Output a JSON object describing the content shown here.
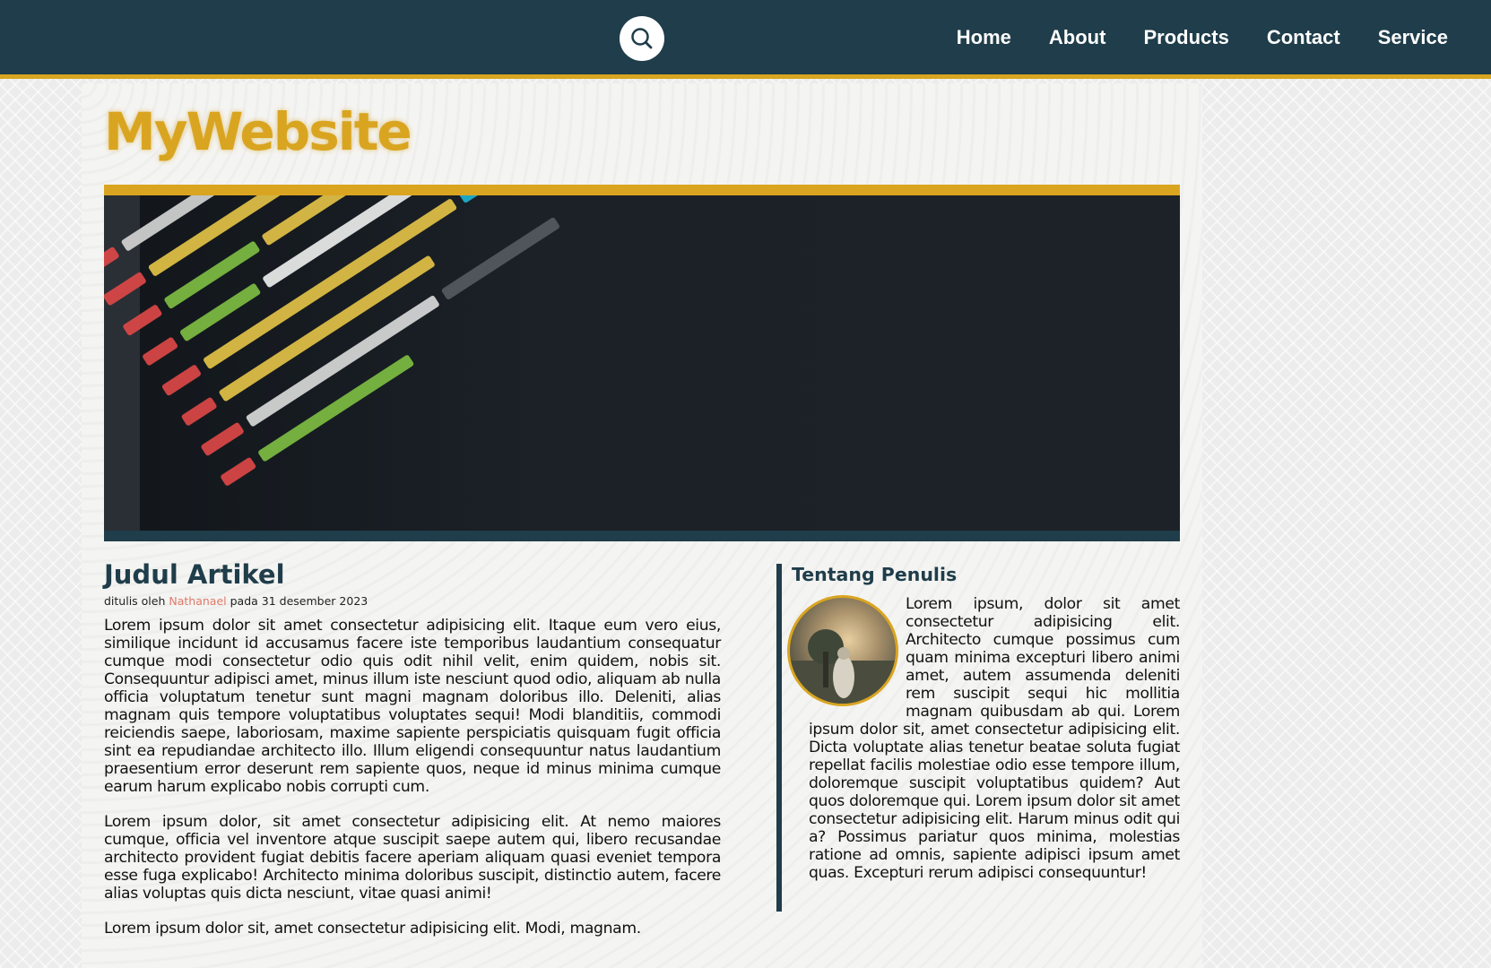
{
  "nav": {
    "search_icon": "search-icon",
    "links": [
      "Home",
      "About",
      "Products",
      "Contact",
      "Service"
    ]
  },
  "site": {
    "title": "MyWebsite"
  },
  "colors": {
    "navy": "#1f3d4a",
    "gold": "#d9a520",
    "author_link": "#e07a6a"
  },
  "article": {
    "title": "Judul Artikel",
    "byline_prefix": "ditulis oleh",
    "author": "Nathanael",
    "byline_suffix": "pada 31 desember 2023",
    "paragraphs": [
      "Lorem ipsum dolor sit amet consectetur adipisicing elit. Itaque eum vero eius, similique incidunt id accusamus facere iste temporibus laudantium consequatur cumque modi consectetur odio quis odit nihil velit, enim quidem, nobis sit. Consequuntur adipisci amet, minus illum iste nesciunt quod odio, aliquam ab nulla officia voluptatum tenetur sunt magni magnam doloribus illo. Deleniti, alias magnam quis tempore voluptatibus voluptates sequi! Modi blanditiis, commodi reiciendis saepe, laboriosam, maxime sapiente perspiciatis quisquam fugit officia sint ea repudiandae architecto illo. Illum eligendi consequuntur natus laudantium praesentium error deserunt rem sapiente quos, neque id minus minima cumque earum harum explicabo nobis corrupti cum.",
      "Lorem ipsum dolor, sit amet consectetur adipisicing elit. At nemo maiores cumque, officia vel inventore atque suscipit saepe autem qui, libero recusandae architecto provident fugiat debitis facere aperiam aliquam quasi eveniet tempora esse fuga explicabo! Architecto minima doloribus suscipit, distinctio autem, facere alias voluptas quis dicta nesciunt, vitae quasi animi!",
      "Lorem ipsum dolor sit, amet consectetur adipisicing elit. Modi, magnam."
    ]
  },
  "sidebar": {
    "title": "Tentang Penulis",
    "text": "Lorem ipsum, dolor sit amet consectetur adipisicing elit. Architecto cumque possimus cum quam minima excepturi libero animi amet, autem assumenda deleniti rem suscipit sequi hic mollitia magnam quibusdam ab qui. Lorem ipsum dolor sit, amet consectetur adipisicing elit. Dicta voluptate alias tenetur beatae soluta fugiat repellat facilis molestiae odio esse tempore illum, doloremque suscipit voluptatibus quidem? Aut quos doloremque qui. Lorem ipsum dolor sit amet consectetur adipisicing elit. Harum minus odit qui a? Possimus pariatur quos minima, molestias ratione ad omnis, sapiente adipisci ipsum amet quas. Excepturi rerum adipisci consequuntur!"
  }
}
